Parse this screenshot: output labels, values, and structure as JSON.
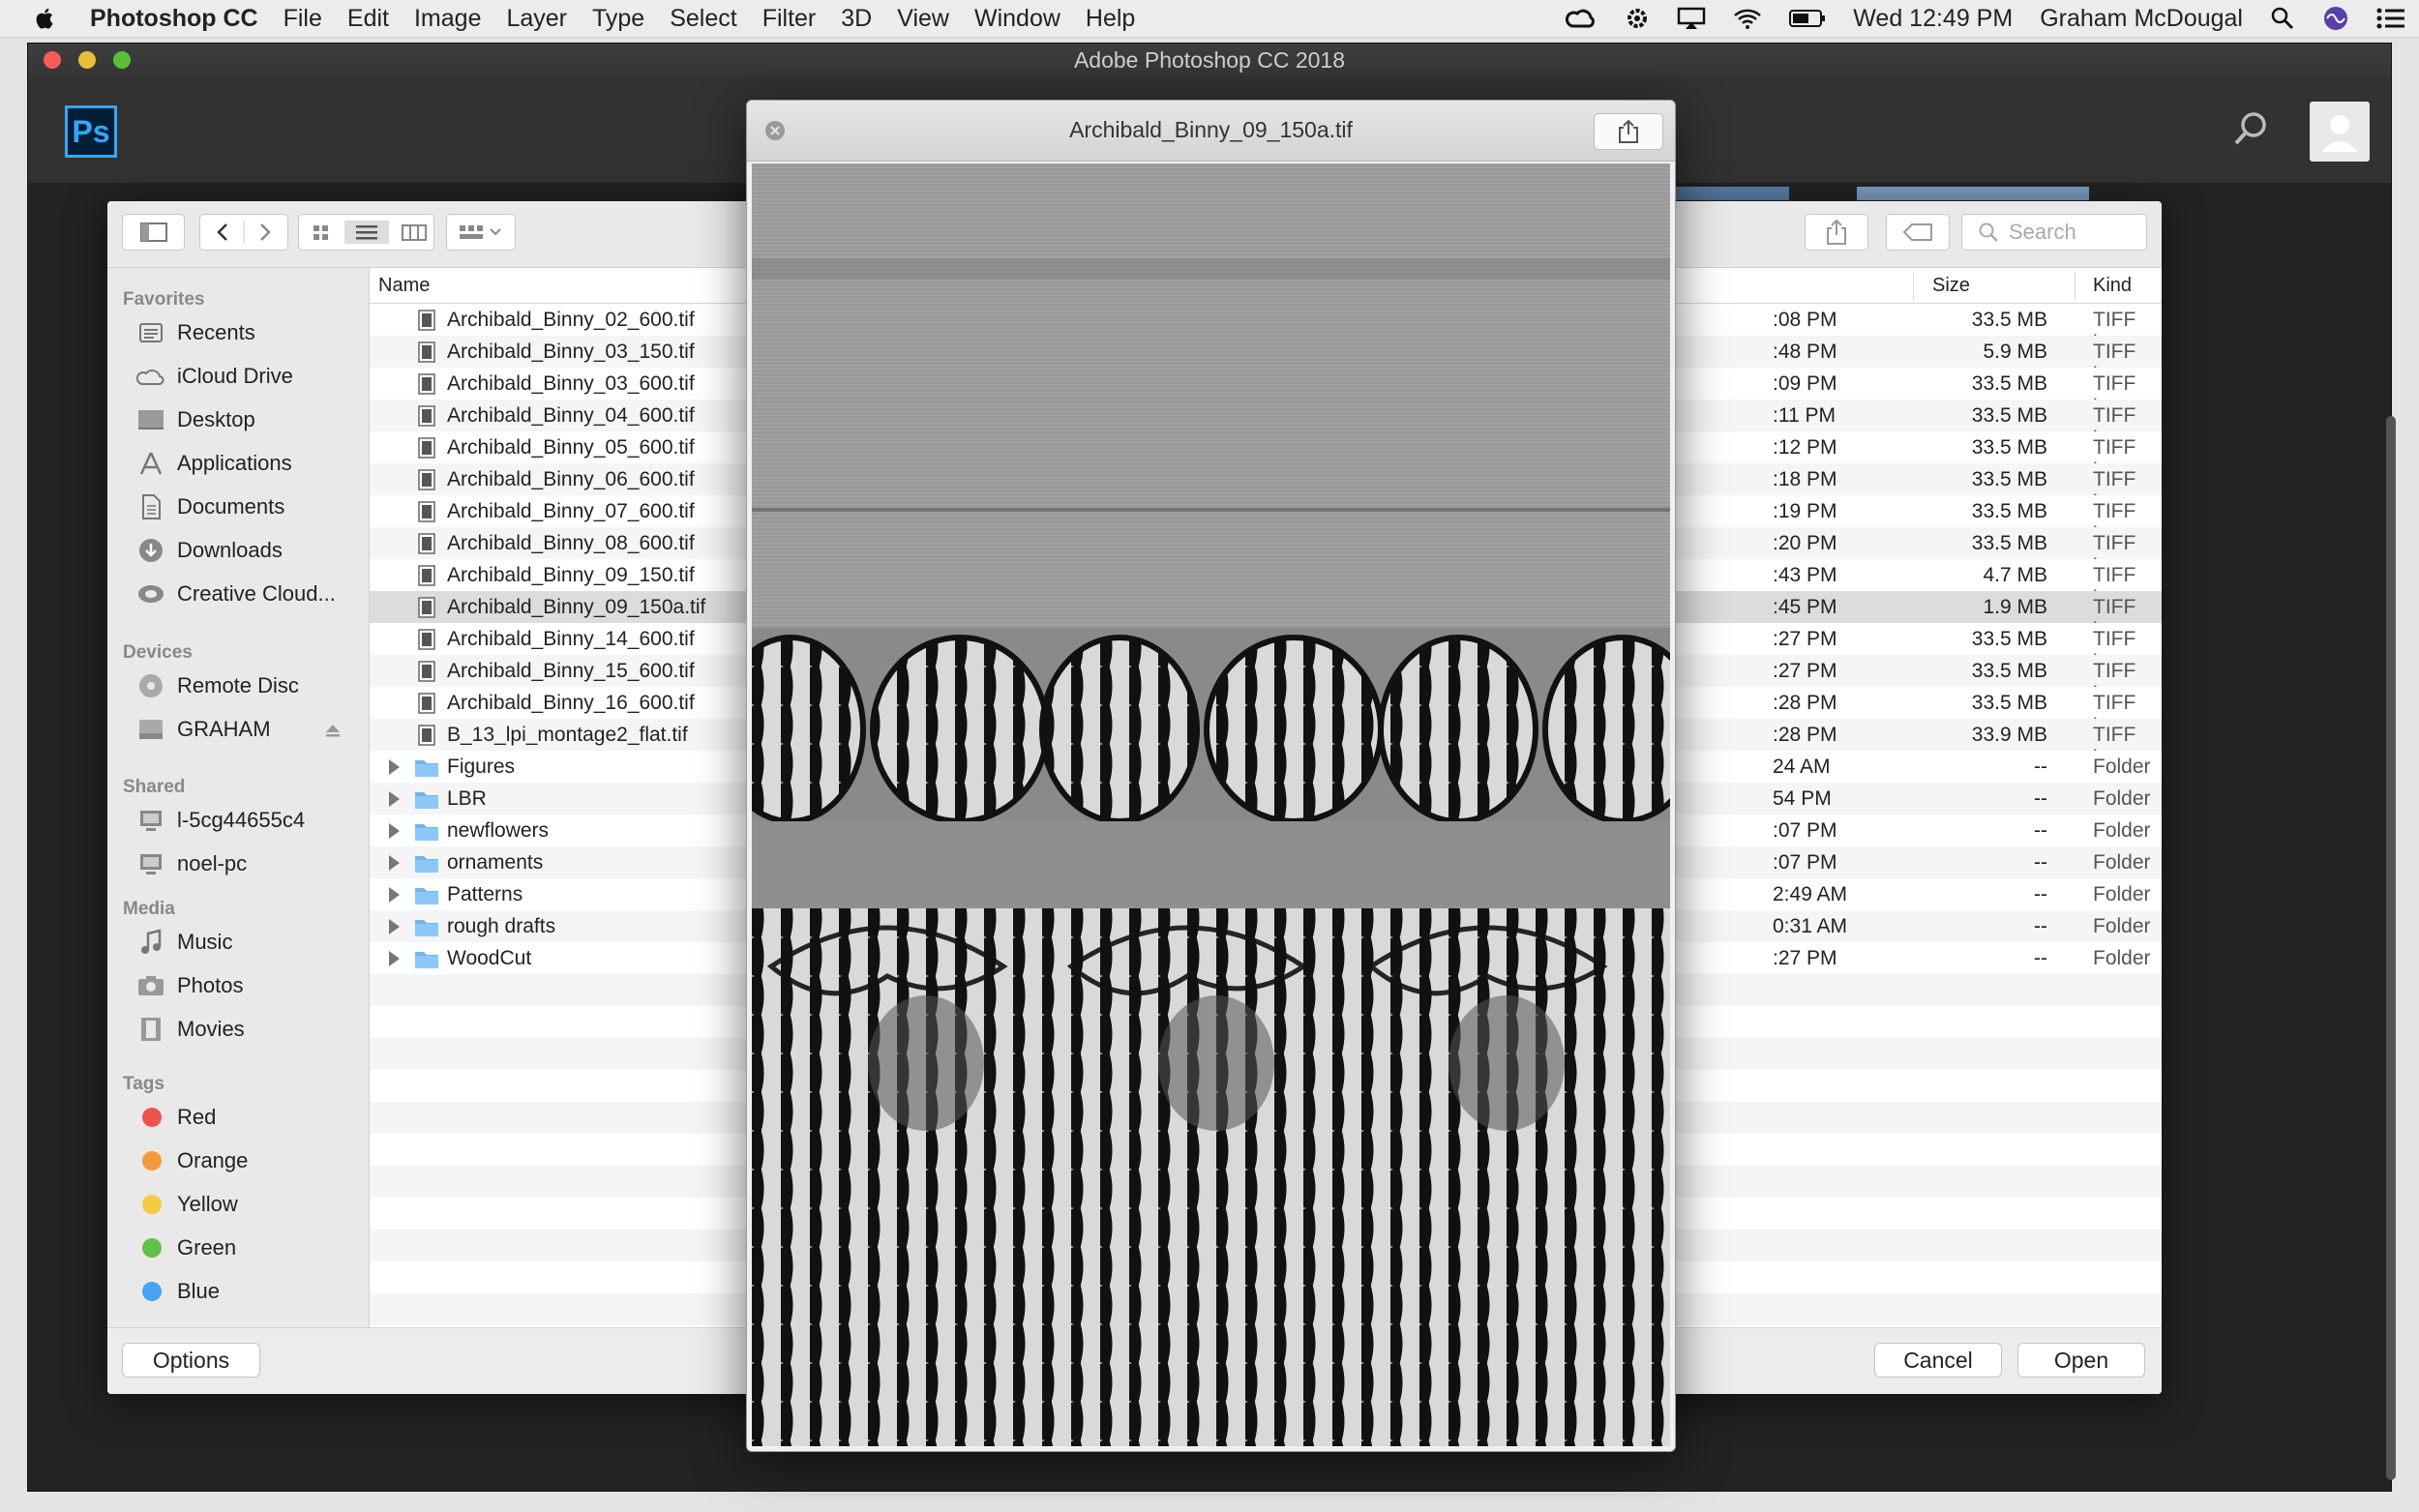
{
  "menubar": {
    "app": "Photoshop CC",
    "items": [
      "File",
      "Edit",
      "Image",
      "Layer",
      "Type",
      "Select",
      "Filter",
      "3D",
      "View",
      "Window",
      "Help"
    ],
    "clock": "Wed 12:49 PM",
    "user": "Graham McDougal"
  },
  "photoshop": {
    "window_title": "Adobe Photoshop CC 2018",
    "logo": "Ps"
  },
  "dialog": {
    "search_placeholder": "Search",
    "columns": {
      "name": "Name",
      "size": "Size",
      "kind": "Kind"
    },
    "sidebar": {
      "favorites_header": "Favorites",
      "favorites": [
        {
          "label": "Recents",
          "icon": "recents-icon"
        },
        {
          "label": "iCloud Drive",
          "icon": "cloud-icon"
        },
        {
          "label": "Desktop",
          "icon": "desktop-icon"
        },
        {
          "label": "Applications",
          "icon": "applications-icon"
        },
        {
          "label": "Documents",
          "icon": "documents-icon"
        },
        {
          "label": "Downloads",
          "icon": "downloads-icon"
        },
        {
          "label": "Creative Cloud...",
          "icon": "creative-cloud-icon"
        }
      ],
      "devices_header": "Devices",
      "devices": [
        {
          "label": "Remote Disc",
          "icon": "disc-icon"
        },
        {
          "label": "GRAHAM",
          "icon": "drive-icon"
        }
      ],
      "shared_header": "Shared",
      "shared": [
        {
          "label": "l-5cg44655c4",
          "icon": "computer-icon"
        },
        {
          "label": "noel-pc",
          "icon": "computer-icon"
        }
      ],
      "media_header": "Media",
      "media": [
        {
          "label": "Music",
          "icon": "music-icon"
        },
        {
          "label": "Photos",
          "icon": "camera-icon"
        },
        {
          "label": "Movies",
          "icon": "film-icon"
        }
      ],
      "tags_header": "Tags",
      "tags": [
        {
          "label": "Red",
          "color": "#f0524f"
        },
        {
          "label": "Orange",
          "color": "#f59a3c"
        },
        {
          "label": "Yellow",
          "color": "#f6c944"
        },
        {
          "label": "Green",
          "color": "#63c04a"
        },
        {
          "label": "Blue",
          "color": "#47a3f3"
        }
      ]
    },
    "files": [
      {
        "name": "Archibald_Binny_02_600.tif",
        "date": ":08 PM",
        "size": "33.5 MB",
        "kind": "TIFF image",
        "type": "file"
      },
      {
        "name": "Archibald_Binny_03_150.tif",
        "date": ":48 PM",
        "size": "5.9 MB",
        "kind": "TIFF image",
        "type": "file"
      },
      {
        "name": "Archibald_Binny_03_600.tif",
        "date": ":09 PM",
        "size": "33.5 MB",
        "kind": "TIFF image",
        "type": "file"
      },
      {
        "name": "Archibald_Binny_04_600.tif",
        "date": ":11 PM",
        "size": "33.5 MB",
        "kind": "TIFF image",
        "type": "file"
      },
      {
        "name": "Archibald_Binny_05_600.tif",
        "date": ":12 PM",
        "size": "33.5 MB",
        "kind": "TIFF image",
        "type": "file"
      },
      {
        "name": "Archibald_Binny_06_600.tif",
        "date": ":18 PM",
        "size": "33.5 MB",
        "kind": "TIFF image",
        "type": "file"
      },
      {
        "name": "Archibald_Binny_07_600.tif",
        "date": ":19 PM",
        "size": "33.5 MB",
        "kind": "TIFF image",
        "type": "file"
      },
      {
        "name": "Archibald_Binny_08_600.tif",
        "date": ":20 PM",
        "size": "33.5 MB",
        "kind": "TIFF image",
        "type": "file"
      },
      {
        "name": "Archibald_Binny_09_150.tif",
        "date": ":43 PM",
        "size": "4.7 MB",
        "kind": "TIFF image",
        "type": "file"
      },
      {
        "name": "Archibald_Binny_09_150a.tif",
        "date": ":45 PM",
        "size": "1.9 MB",
        "kind": "TIFF image",
        "type": "file",
        "selected": true
      },
      {
        "name": "Archibald_Binny_14_600.tif",
        "date": ":27 PM",
        "size": "33.5 MB",
        "kind": "TIFF image",
        "type": "file"
      },
      {
        "name": "Archibald_Binny_15_600.tif",
        "date": ":27 PM",
        "size": "33.5 MB",
        "kind": "TIFF image",
        "type": "file"
      },
      {
        "name": "Archibald_Binny_16_600.tif",
        "date": ":28 PM",
        "size": "33.5 MB",
        "kind": "TIFF image",
        "type": "file"
      },
      {
        "name": "B_13_lpi_montage2_flat.tif",
        "date": ":28 PM",
        "size": "33.9 MB",
        "kind": "TIFF image",
        "type": "file"
      },
      {
        "name": "Figures",
        "date": "24 AM",
        "size": "--",
        "kind": "Folder",
        "type": "folder"
      },
      {
        "name": "LBR",
        "date": "54 PM",
        "size": "--",
        "kind": "Folder",
        "type": "folder"
      },
      {
        "name": "newflowers",
        "date": ":07 PM",
        "size": "--",
        "kind": "Folder",
        "type": "folder"
      },
      {
        "name": "ornaments",
        "date": ":07 PM",
        "size": "--",
        "kind": "Folder",
        "type": "folder"
      },
      {
        "name": "Patterns",
        "date": "2:49 AM",
        "size": "--",
        "kind": "Folder",
        "type": "folder"
      },
      {
        "name": "rough drafts",
        "date": "0:31 AM",
        "size": "--",
        "kind": "Folder",
        "type": "folder"
      },
      {
        "name": "WoodCut",
        "date": ":27 PM",
        "size": "--",
        "kind": "Folder",
        "type": "folder"
      }
    ],
    "options_label": "Options",
    "cancel_label": "Cancel",
    "open_label": "Open"
  },
  "quicklook": {
    "title": "Archibald_Binny_09_150a.tif"
  }
}
